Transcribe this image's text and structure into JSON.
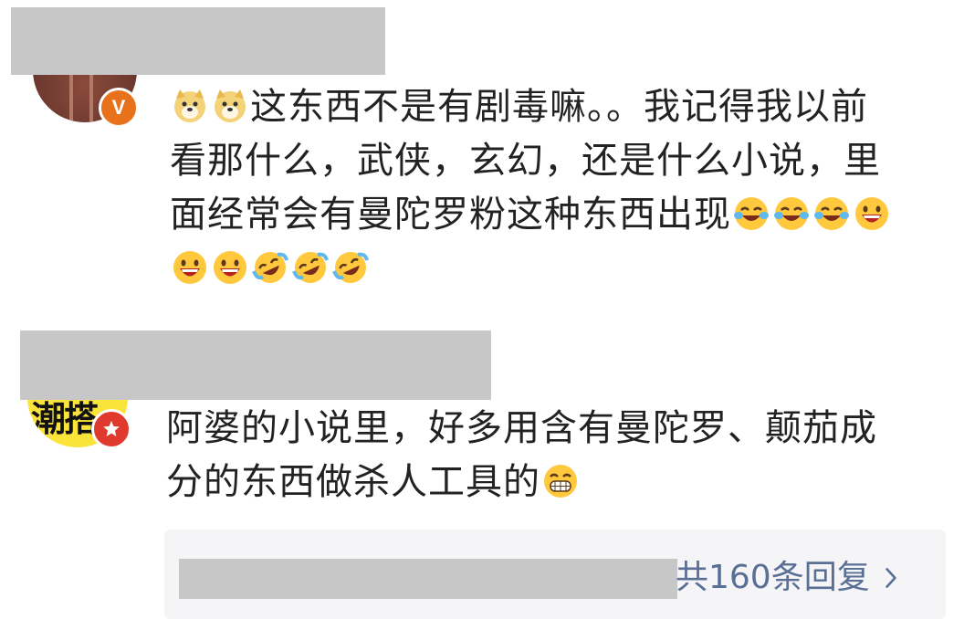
{
  "comments": [
    {
      "author_redacted": true,
      "avatar": "user-avatar",
      "badge": {
        "icon": "verified-v-icon",
        "text": "V",
        "color": "#e8711c"
      },
      "lines": [
        "这东西不是有剧毒嘛。。我记得我以前",
        "看那什么，武侠，玄幻，还是什么小说，里",
        "面经常会有曼陀罗粉这种东西出现",
        ""
      ],
      "emojis": {
        "line1_prefix": [
          "doge-emoji",
          "doge-emoji"
        ],
        "line3_suffix": [
          "laugh-cry-emoji",
          "laugh-cry-emoji",
          "laugh-cry-emoji",
          "grin-emoji"
        ],
        "line4": [
          "grin-emoji",
          "grin-emoji",
          "rofl-emoji",
          "rofl-emoji",
          "rofl-emoji"
        ]
      }
    },
    {
      "author_redacted": true,
      "avatar": "user-avatar",
      "avatar_text": "潮搭",
      "badge": {
        "icon": "star-badge-icon",
        "color": "#e03a2f"
      },
      "lines": [
        "阿婆的小说里，好多用含有曼陀罗、颠茄成",
        "分的东西做杀人工具的"
      ],
      "emojis": {
        "line2_suffix": [
          "big-grin-emoji"
        ]
      }
    }
  ],
  "replies": {
    "label": "共160条回复",
    "icon": "chevron-right-icon"
  },
  "colors": {
    "link": "#5a6f95",
    "redaction": "#c7c7c7",
    "reply_bg": "#f5f5f7"
  }
}
